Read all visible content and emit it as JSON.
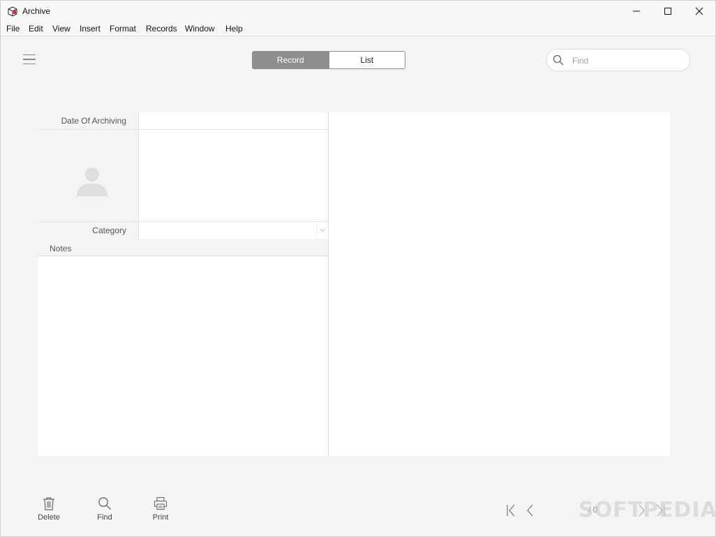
{
  "window": {
    "title": "Archive",
    "controls": [
      "minimize-icon",
      "maximize-icon",
      "close-icon"
    ]
  },
  "menu": [
    "File",
    "Edit",
    "View",
    "Insert",
    "Format",
    "Records",
    "Window",
    "Help"
  ],
  "toolbar": {
    "menu_icon": "hamburger-icon",
    "view_tabs": [
      {
        "label": "Record",
        "active": true
      },
      {
        "label": "List",
        "active": false
      }
    ],
    "search": {
      "placeholder": "Find",
      "value": ""
    }
  },
  "form": {
    "fields": [
      {
        "label": "Date Of Archiving",
        "value": ""
      },
      {
        "label": "Category",
        "value": ""
      }
    ],
    "photo_placeholder_icon": "person-placeholder-icon",
    "notes": {
      "label": "Notes",
      "value": ""
    }
  },
  "bottom_toolbar": {
    "actions": [
      {
        "label": "Delete",
        "icon": "trash-icon"
      },
      {
        "label": "Find",
        "icon": "search-icon"
      },
      {
        "label": "Print",
        "icon": "printer-icon"
      }
    ],
    "pager": {
      "text": "/ 0"
    }
  },
  "watermark": "SOFTPEDIA",
  "colors": {
    "active_tab": "#8e8e8e",
    "background": "#f4f4f4",
    "panel": "#ffffff"
  }
}
